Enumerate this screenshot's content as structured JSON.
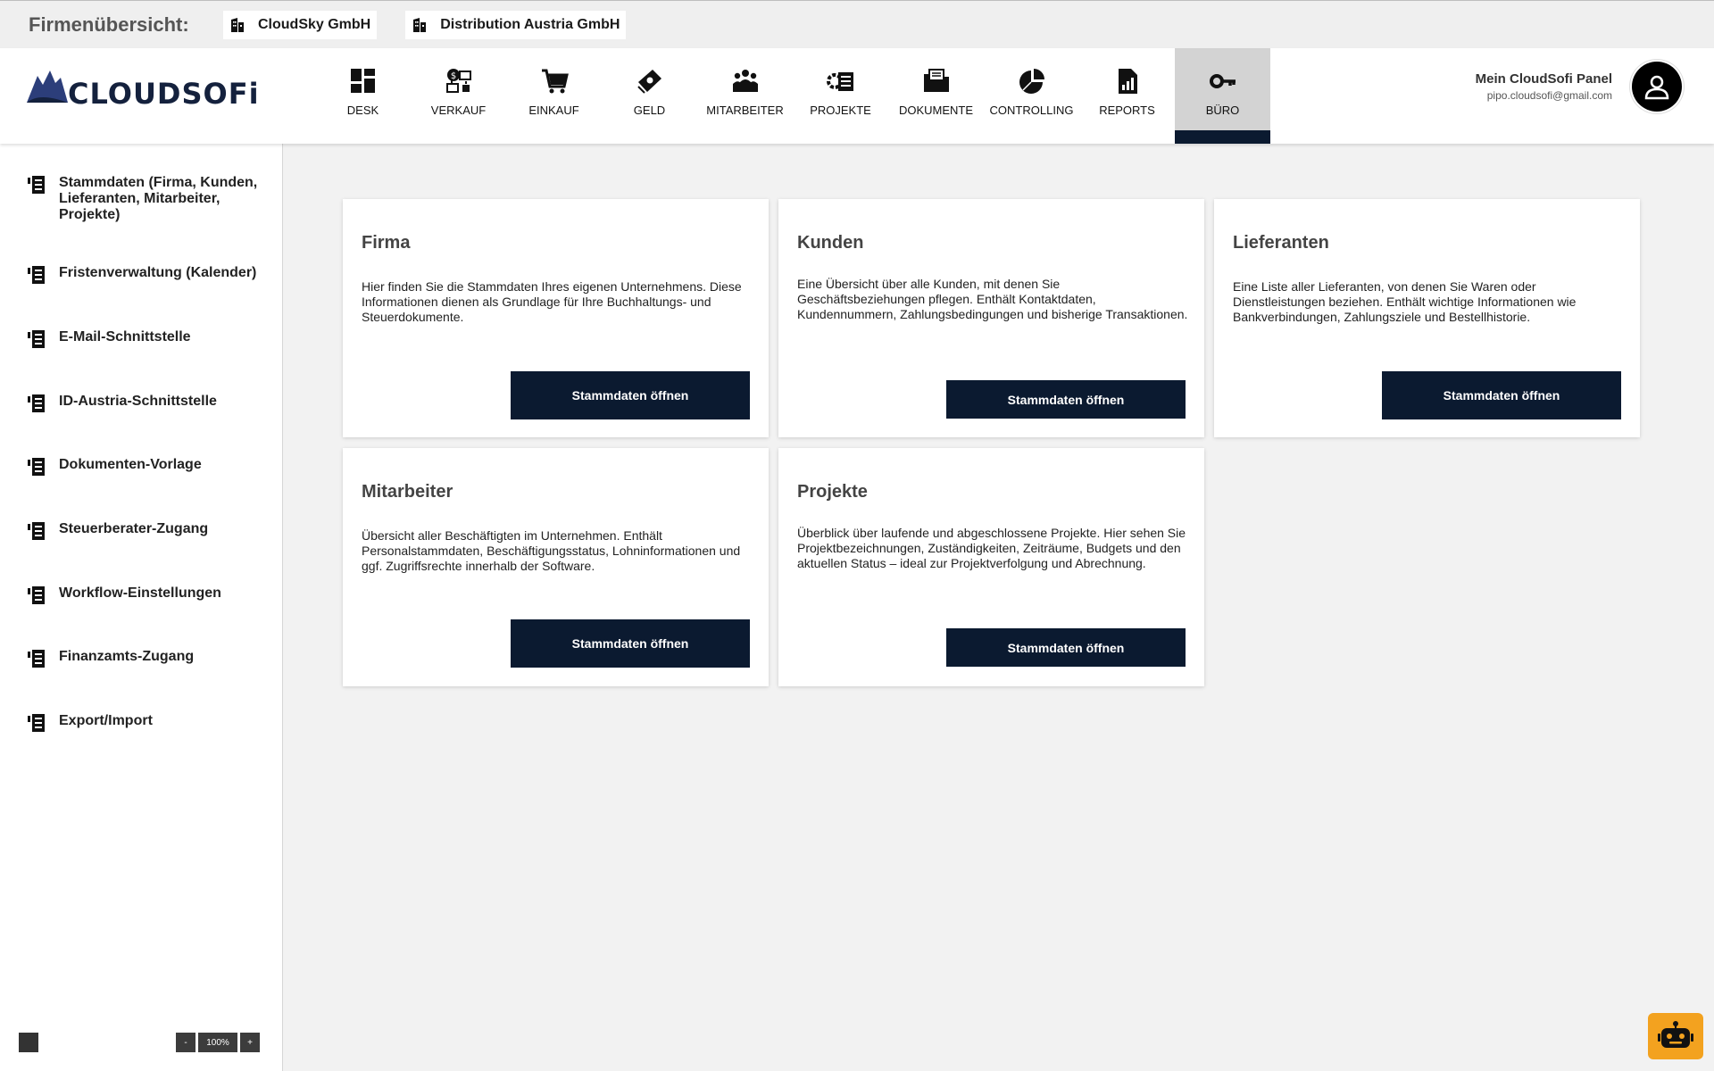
{
  "companyBar": {
    "label": "Firmenübersicht:",
    "companies": [
      "CloudSky GmbH",
      "Distribution Austria GmbH"
    ]
  },
  "logo": {
    "text": "CLOUDSOFi"
  },
  "nav": [
    {
      "label": "DESK",
      "icon": "dashboard-icon"
    },
    {
      "label": "VERKAUF",
      "icon": "sales-icon"
    },
    {
      "label": "EINKAUF",
      "icon": "cart-icon"
    },
    {
      "label": "GELD",
      "icon": "money-icon"
    },
    {
      "label": "MITARBEITER",
      "icon": "people-icon"
    },
    {
      "label": "PROJEKTE",
      "icon": "projects-icon"
    },
    {
      "label": "DOKUMENTE",
      "icon": "folder-icon"
    },
    {
      "label": "CONTROLLING",
      "icon": "pie-chart-icon"
    },
    {
      "label": "REPORTS",
      "icon": "report-icon"
    },
    {
      "label": "BÜRO",
      "icon": "key-icon",
      "active": true
    }
  ],
  "user": {
    "title": "Mein CloudSofi Panel",
    "email": "pipo.cloudsofi@gmail.com"
  },
  "sidebar": [
    "Stammdaten (Firma, Kunden, Lieferanten, Mitarbeiter, Projekte)",
    "Fristenverwaltung (Kalender)",
    "E-Mail-Schnittstelle",
    "ID-Austria-Schnittstelle",
    "Dokumenten-Vorlage",
    "Steuerberater-Zugang",
    "Workflow-Einstellungen",
    "Finanzamts-Zugang",
    "Export/Import"
  ],
  "zoom": {
    "minus": "-",
    "value": "100%",
    "plus": "+"
  },
  "cards": [
    {
      "title": "Firma",
      "text": "Hier finden Sie die Stammdaten Ihres eigenen Unternehmens. Diese Informationen dienen als Grundlage für Ihre Buchhaltungs- und Steuerdokumente.",
      "button": "Stammdaten öffnen"
    },
    {
      "title": "Kunden",
      "text": "Eine Übersicht über alle Kunden, mit denen Sie Geschäftsbeziehungen pflegen. Enthält Kontaktdaten, Kundennummern, Zahlungsbedingungen und bisherige Transaktionen.",
      "button": "Stammdaten öffnen"
    },
    {
      "title": "Lieferanten",
      "text": "Eine Liste aller Lieferanten, von denen Sie Waren oder Dienstleistungen beziehen. Enthält wichtige Informationen wie Bankverbindungen, Zahlungsziele und Bestellhistorie.",
      "button": "Stammdaten öffnen"
    },
    {
      "title": "Mitarbeiter",
      "text": "Übersicht aller Beschäftigten im Unternehmen. Enthält Personalstammdaten, Beschäftigungsstatus, Lohninformationen und ggf. Zugriffsrechte innerhalb der Software.",
      "button": "Stammdaten öffnen"
    },
    {
      "title": "Projekte",
      "text": "Überblick über laufende und abgeschlossene Projekte. Hier sehen Sie Projektbezeichnungen, Zuständigkeiten, Zeiträume, Budgets und den aktuellen Status – ideal zur Projektverfolgung und Abrechnung.",
      "button": "Stammdaten öffnen"
    }
  ],
  "colors": {
    "navy": "#0b1a30",
    "accent": "#f3a21f"
  }
}
